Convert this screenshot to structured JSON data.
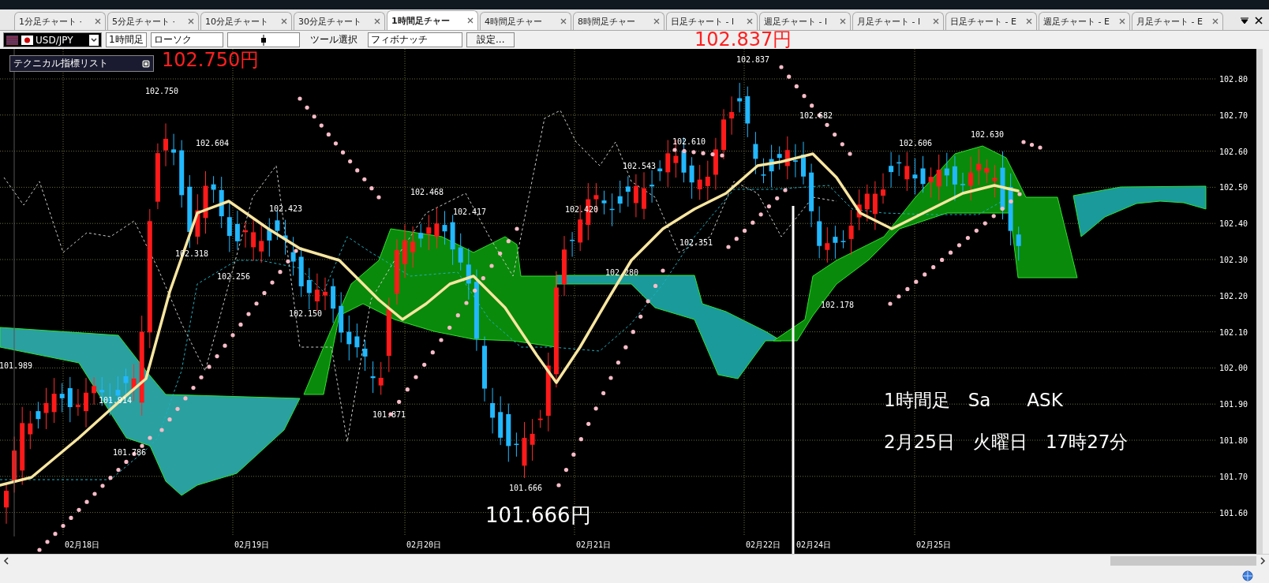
{
  "tabs": [
    {
      "label": "1分足チャート ·",
      "selected": false
    },
    {
      "label": "5分足チャート ·",
      "selected": false
    },
    {
      "label": "10分足チャート",
      "selected": false
    },
    {
      "label": "30分足チャート",
      "selected": false
    },
    {
      "label": "1時間足チャー",
      "selected": true
    },
    {
      "label": "4時間足チャー",
      "selected": false
    },
    {
      "label": "8時間足チャー",
      "selected": false
    },
    {
      "label": "日足チャート - l",
      "selected": false
    },
    {
      "label": "週足チャート - l",
      "selected": false
    },
    {
      "label": "月足チャート - l",
      "selected": false
    },
    {
      "label": "日足チャート - E",
      "selected": false
    },
    {
      "label": "週足チャート - E",
      "selected": false
    },
    {
      "label": "月足チャート - E",
      "selected": false
    }
  ],
  "toolbar": {
    "symbol": "USD/JPY",
    "period": "1時間足",
    "chart_type": "ローソク",
    "tool_label": "ツール選択",
    "tool": "フィボナッチ",
    "settings_button": "設定..."
  },
  "indicator_panel": {
    "title": "テクニカル指標リスト"
  },
  "chart": {
    "y_axis": [
      "102.80",
      "102.70",
      "102.60",
      "102.50",
      "102.40",
      "102.30",
      "102.20",
      "102.10",
      "102.00",
      "101.90",
      "101.80",
      "101.70",
      "101.60"
    ],
    "x_axis": [
      "02月18日",
      "02月19日",
      "02月20日",
      "02月21日",
      "02月22日",
      "02月24日",
      "02月25日"
    ],
    "price_labels": [
      "102.750",
      "102.604",
      "102.318",
      "102.256",
      "102.423",
      "102.150",
      "102.468",
      "102.417",
      "101.871",
      "101.914",
      "101.786",
      "101.989",
      "101.666",
      "102.420",
      "102.280",
      "102.543",
      "102.610",
      "102.351",
      "102.837",
      "102.682",
      "102.178",
      "102.606",
      "102.630"
    ],
    "price_marks": [
      {
        "text": "102.750円",
        "color": "#ff2020"
      },
      {
        "text": "102.837円",
        "color": "#ff2020"
      },
      {
        "text": "101.666円",
        "color": "#ffffff"
      }
    ],
    "caption_lines": [
      "1時間足　Sa　　ASK",
      "2月25日　火曜日　17時27分"
    ]
  }
}
